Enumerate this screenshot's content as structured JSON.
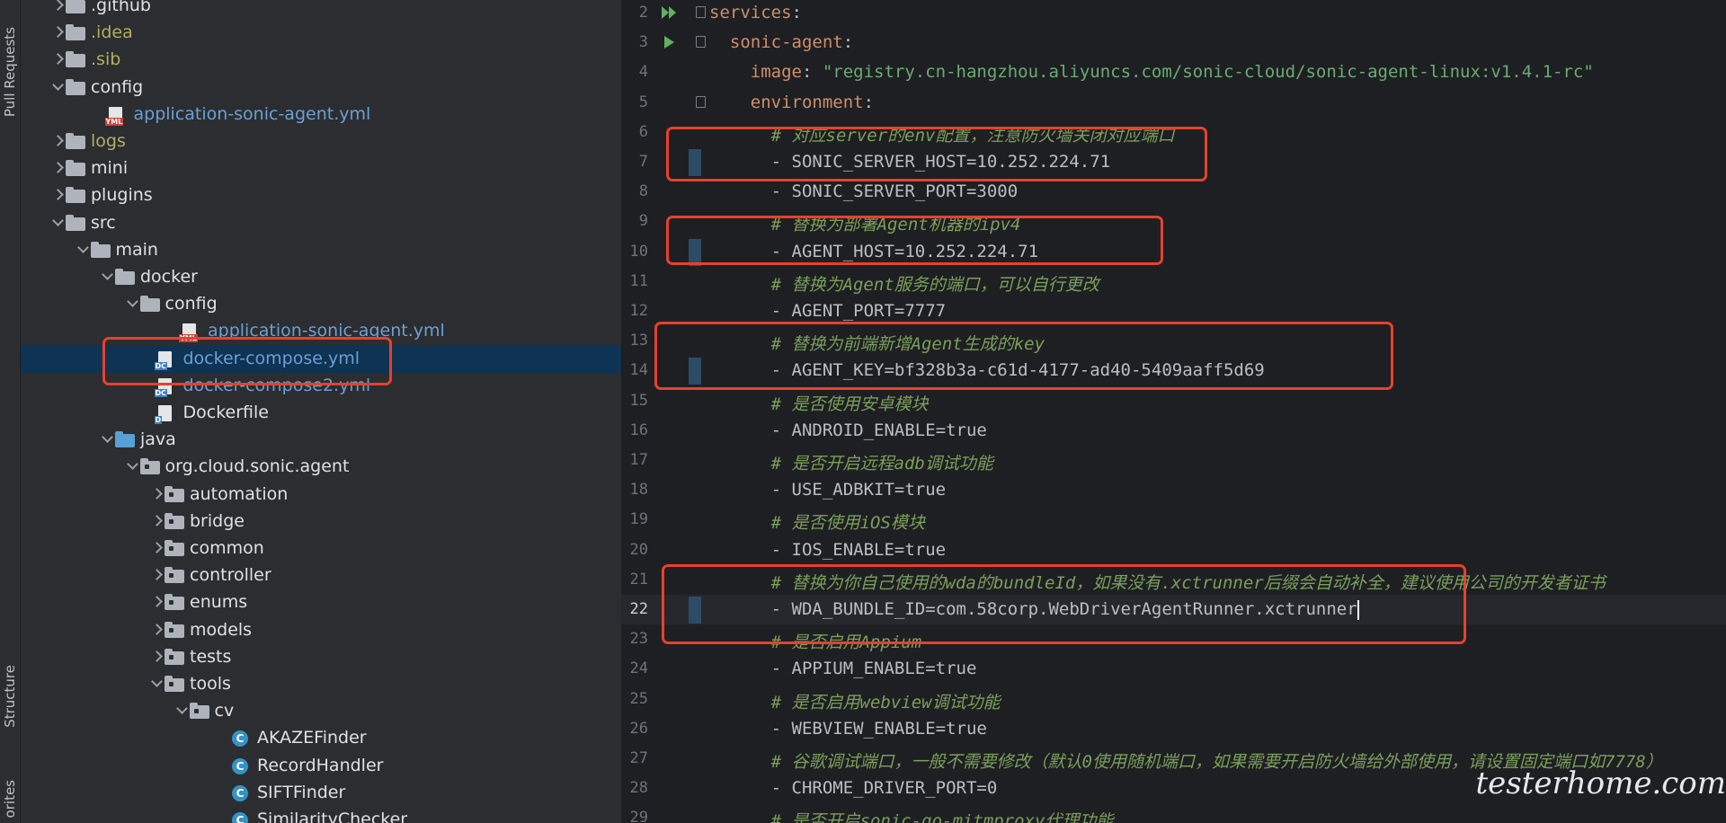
{
  "side_stripe": {
    "pull_requests": "Pull Requests",
    "structure": "Structure",
    "favorites": "orites"
  },
  "tree": [
    {
      "label": ".github",
      "arrow": "collapsed",
      "icon": "folder-icon",
      "color": "normal"
    },
    {
      "label": ".idea",
      "arrow": "collapsed",
      "icon": "folder-icon",
      "color": "olive"
    },
    {
      "label": ".sib",
      "arrow": "collapsed",
      "icon": "folder-icon",
      "color": "olive"
    },
    {
      "label": "config",
      "arrow": "expanded",
      "icon": "folder-icon",
      "color": "normal"
    },
    {
      "label": "application-sonic-agent.yml",
      "arrow": "none",
      "icon": "yml-file-icon",
      "color": "blue"
    },
    {
      "label": "logs",
      "arrow": "collapsed",
      "icon": "folder-icon",
      "color": "olive"
    },
    {
      "label": "mini",
      "arrow": "collapsed",
      "icon": "folder-icon",
      "color": "normal"
    },
    {
      "label": "plugins",
      "arrow": "collapsed",
      "icon": "folder-icon",
      "color": "normal"
    },
    {
      "label": "src",
      "arrow": "expanded",
      "icon": "folder-icon",
      "color": "normal"
    },
    {
      "label": "main",
      "arrow": "expanded",
      "icon": "folder-icon",
      "color": "normal"
    },
    {
      "label": "docker",
      "arrow": "expanded",
      "icon": "folder-icon",
      "color": "normal"
    },
    {
      "label": "config",
      "arrow": "expanded",
      "icon": "folder-icon",
      "color": "normal"
    },
    {
      "label": "application-sonic-agent.yml",
      "arrow": "none",
      "icon": "yml-file-icon",
      "color": "blue"
    },
    {
      "label": "docker-compose.yml",
      "arrow": "none",
      "icon": "docker-compose-file-icon",
      "color": "blue",
      "selected": true
    },
    {
      "label": "docker-compose2.yml",
      "arrow": "none",
      "icon": "docker-compose-file-icon",
      "color": "blue"
    },
    {
      "label": "Dockerfile",
      "arrow": "none",
      "icon": "dockerfile-icon",
      "color": "normal"
    },
    {
      "label": "java",
      "arrow": "expanded",
      "icon": "source-folder-icon",
      "color": "normal"
    },
    {
      "label": "org.cloud.sonic.agent",
      "arrow": "expanded",
      "icon": "package-icon",
      "color": "normal"
    },
    {
      "label": "automation",
      "arrow": "collapsed",
      "icon": "package-icon",
      "color": "normal"
    },
    {
      "label": "bridge",
      "arrow": "collapsed",
      "icon": "package-icon",
      "color": "normal"
    },
    {
      "label": "common",
      "arrow": "collapsed",
      "icon": "package-icon",
      "color": "normal"
    },
    {
      "label": "controller",
      "arrow": "collapsed",
      "icon": "package-icon",
      "color": "normal"
    },
    {
      "label": "enums",
      "arrow": "collapsed",
      "icon": "package-icon",
      "color": "normal"
    },
    {
      "label": "models",
      "arrow": "collapsed",
      "icon": "package-icon",
      "color": "normal"
    },
    {
      "label": "tests",
      "arrow": "collapsed",
      "icon": "package-icon",
      "color": "normal"
    },
    {
      "label": "tools",
      "arrow": "expanded",
      "icon": "package-icon",
      "color": "normal"
    },
    {
      "label": "cv",
      "arrow": "expanded",
      "icon": "package-icon",
      "color": "normal"
    },
    {
      "label": "AKAZEFinder",
      "arrow": "none",
      "icon": "class-icon",
      "color": "normal"
    },
    {
      "label": "RecordHandler",
      "arrow": "none",
      "icon": "class-icon",
      "color": "normal"
    },
    {
      "label": "SIFTFinder",
      "arrow": "none",
      "icon": "class-icon",
      "color": "normal"
    },
    {
      "label": "SimilarityChecker",
      "arrow": "none",
      "icon": "class-icon",
      "color": "normal"
    }
  ],
  "editor": {
    "current_line": "22",
    "lines": [
      {
        "num": "2",
        "parts": [
          {
            "t": "services",
            "c": "k"
          },
          {
            "t": ":",
            "c": ""
          }
        ]
      },
      {
        "num": "3",
        "parts": [
          {
            "t": "  sonic-agent",
            "c": "k"
          },
          {
            "t": ":",
            "c": ""
          }
        ]
      },
      {
        "num": "4",
        "parts": [
          {
            "t": "    image",
            "c": "k"
          },
          {
            "t": ": ",
            "c": ""
          },
          {
            "t": "\"registry.cn-hangzhou.aliyuncs.com/sonic-cloud/sonic-agent-linux:v1.4.1-rc\"",
            "c": "s"
          }
        ]
      },
      {
        "num": "5",
        "parts": [
          {
            "t": "    environment",
            "c": "k"
          },
          {
            "t": ":",
            "c": ""
          }
        ]
      },
      {
        "num": "6",
        "parts": [
          {
            "t": "      # 对应server的env配置，注意防火墙关闭对应端口",
            "c": "c"
          }
        ]
      },
      {
        "num": "7",
        "parts": [
          {
            "t": "      - SONIC_SERVER_HOST=10.252.224.71",
            "c": ""
          }
        ]
      },
      {
        "num": "8",
        "parts": [
          {
            "t": "      - SONIC_SERVER_PORT=3000",
            "c": ""
          }
        ]
      },
      {
        "num": "9",
        "parts": [
          {
            "t": "      # 替换为部署Agent机器的ipv4",
            "c": "c"
          }
        ]
      },
      {
        "num": "10",
        "parts": [
          {
            "t": "      - AGENT_HOST=10.252.224.71",
            "c": ""
          }
        ]
      },
      {
        "num": "11",
        "parts": [
          {
            "t": "      # 替换为Agent服务的端口，可以自行更改",
            "c": "c"
          }
        ]
      },
      {
        "num": "12",
        "parts": [
          {
            "t": "      - AGENT_PORT=7777",
            "c": ""
          }
        ]
      },
      {
        "num": "13",
        "parts": [
          {
            "t": "      # 替换为前端新增Agent生成的key",
            "c": "c"
          }
        ]
      },
      {
        "num": "14",
        "parts": [
          {
            "t": "      - AGENT_KEY=bf328b3a-c61d-4177-ad40-5409aaff5d69",
            "c": ""
          }
        ]
      },
      {
        "num": "15",
        "parts": [
          {
            "t": "      # 是否使用安卓模块",
            "c": "c"
          }
        ]
      },
      {
        "num": "16",
        "parts": [
          {
            "t": "      - ANDROID_ENABLE=true",
            "c": ""
          }
        ]
      },
      {
        "num": "17",
        "parts": [
          {
            "t": "      # 是否开启远程adb调试功能",
            "c": "c"
          }
        ]
      },
      {
        "num": "18",
        "parts": [
          {
            "t": "      - USE_ADBKIT=true",
            "c": ""
          }
        ]
      },
      {
        "num": "19",
        "parts": [
          {
            "t": "      # 是否使用iOS模块",
            "c": "c"
          }
        ]
      },
      {
        "num": "20",
        "parts": [
          {
            "t": "      - IOS_ENABLE=true",
            "c": ""
          }
        ]
      },
      {
        "num": "21",
        "parts": [
          {
            "t": "      # 替换为你自己使用的wda的bundleId，如果没有.xctrunner后缀会自动补全，建议使用公司的开发者证书",
            "c": "c"
          }
        ]
      },
      {
        "num": "22",
        "parts": [
          {
            "t": "      - WDA_BUNDLE_ID=com.58corp.WebDriverAgentRunner.xctrunner",
            "c": ""
          }
        ]
      },
      {
        "num": "23",
        "parts": [
          {
            "t": "      # 是否启用Appium",
            "c": "c"
          }
        ]
      },
      {
        "num": "24",
        "parts": [
          {
            "t": "      - APPIUM_ENABLE=true",
            "c": ""
          }
        ]
      },
      {
        "num": "25",
        "parts": [
          {
            "t": "      # 是否启用webview调试功能",
            "c": "c"
          }
        ]
      },
      {
        "num": "26",
        "parts": [
          {
            "t": "      - WEBVIEW_ENABLE=true",
            "c": ""
          }
        ]
      },
      {
        "num": "27",
        "parts": [
          {
            "t": "      # 谷歌调试端口，一般不需要修改（默认0使用随机端口，如果需要开启防火墙给外部使用，请设置固定端口如7778）",
            "c": "c"
          }
        ]
      },
      {
        "num": "28",
        "parts": [
          {
            "t": "      - CHROME_DRIVER_PORT=0",
            "c": ""
          }
        ]
      },
      {
        "num": "29",
        "parts": [
          {
            "t": "      # 是否开启sonic-go-mitmproxy代理功能",
            "c": "c"
          }
        ]
      }
    ]
  },
  "watermark": "testerhome.com",
  "colors": {
    "highlight_box": "#e8402b",
    "selection": "#0e3353",
    "yaml_key": "#cf8e6d",
    "yaml_string": "#6aab73",
    "comment": "#7a9f5b"
  }
}
